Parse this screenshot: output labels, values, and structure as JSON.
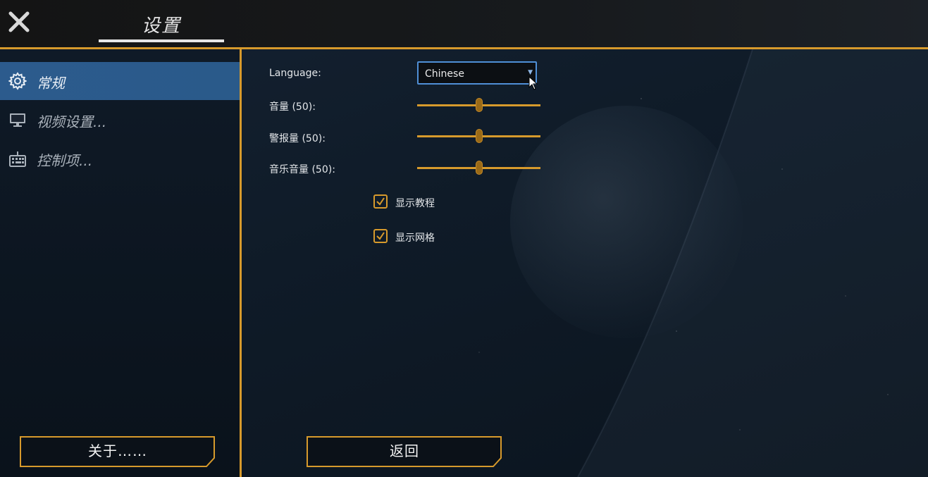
{
  "header": {
    "close_icon": "close-x-icon",
    "title": "设置"
  },
  "sidebar": {
    "items": [
      {
        "label": "常规",
        "icon": "gear-icon",
        "active": true
      },
      {
        "label": "视频设置...",
        "icon": "monitor-icon",
        "active": false
      },
      {
        "label": "控制项...",
        "icon": "keyboard-icon",
        "active": false
      }
    ],
    "about_button": "关于……"
  },
  "settings": {
    "language_label": "Language:",
    "language_value": "Chinese",
    "sliders": [
      {
        "label": "音量 (50):",
        "value": 50,
        "max": 100
      },
      {
        "label": "警报量 (50):",
        "value": 50,
        "max": 100
      },
      {
        "label": "音乐音量 (50):",
        "value": 50,
        "max": 100
      }
    ],
    "checkboxes": [
      {
        "label": "显示教程",
        "checked": true
      },
      {
        "label": "显示网格",
        "checked": true
      }
    ],
    "back_button": "返回"
  },
  "colors": {
    "accent": "#d79a2c",
    "active_nav": "#2c5b8d",
    "select_border": "#4f8fd6"
  }
}
